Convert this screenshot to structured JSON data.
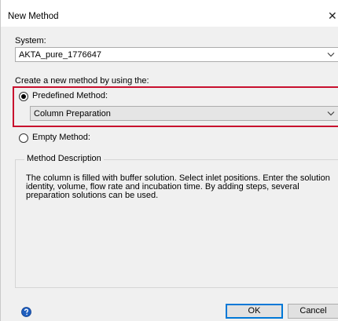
{
  "window": {
    "title": "New Method",
    "close_glyph": "✕"
  },
  "system": {
    "label": "System:",
    "selected": "AKTA_pure_1776647"
  },
  "create_label": "Create a new method by using the:",
  "predefined": {
    "label": "Predefined Method:",
    "checked": true,
    "selected": "Column Preparation"
  },
  "empty": {
    "label": "Empty Method:",
    "checked": false
  },
  "description": {
    "legend": "Method Description",
    "text": "The column is filled with buffer solution. Select inlet positions. Enter the solution\nidentity, volume, flow rate and incubation time. By adding steps, several\npreparation solutions can be used."
  },
  "buttons": {
    "ok": "OK",
    "cancel": "Cancel"
  },
  "icons": {
    "help": "help-icon",
    "chevron": "chevron-down-icon",
    "close": "close-icon"
  },
  "colors": {
    "highlight_frame": "#c8102e",
    "default_button_border": "#0078d7",
    "help_icon": "#1f5fbf"
  }
}
